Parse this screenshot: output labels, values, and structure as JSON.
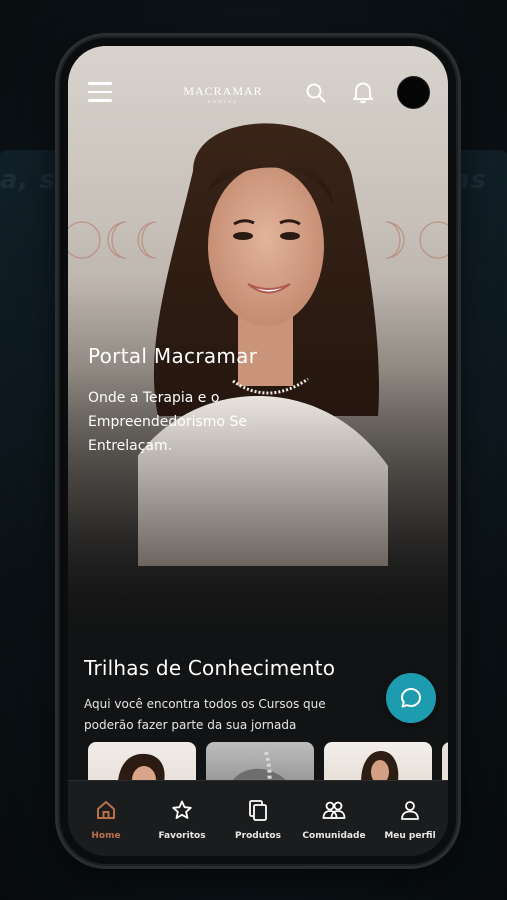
{
  "header": {
    "logo_text": "MACRAMAR",
    "logo_subtext": "PORTAL"
  },
  "hero": {
    "title": "Portal Macramar",
    "subtitle": "Onde a Terapia e o Empreendedorismo Se Entrelaçam."
  },
  "section": {
    "title": "Trilhas de Conhecimento",
    "description": "Aqui você encontra todos os Cursos que poderão fazer parte da sua jornada"
  },
  "bottom_nav": {
    "items": [
      {
        "label": "Home",
        "icon": "home-icon",
        "active": true
      },
      {
        "label": "Favoritos",
        "icon": "star-icon",
        "active": false
      },
      {
        "label": "Produtos",
        "icon": "copy-icon",
        "active": false
      },
      {
        "label": "Comunidade",
        "icon": "users-icon",
        "active": false
      },
      {
        "label": "Meu perfil",
        "icon": "user-icon",
        "active": false
      }
    ]
  },
  "colors": {
    "accent": "#b8704a",
    "chat_button": "#1d9cb0",
    "background": "#121314"
  }
}
